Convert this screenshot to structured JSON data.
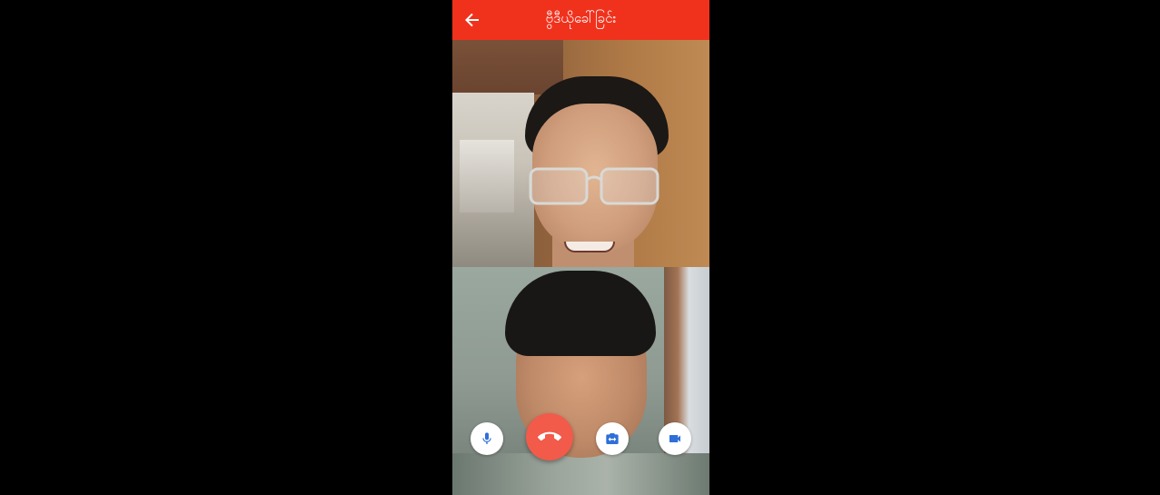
{
  "appbar": {
    "title": "ဗွီဒီယိုခေါ်ခြင်း",
    "background": "#f0321d",
    "back_icon": "arrow-back-icon"
  },
  "call": {
    "remote_feed": "remote-participant-video",
    "local_feed": "local-camera-preview",
    "controls": [
      {
        "name": "microphone-button",
        "icon": "microphone-icon",
        "color": "#2f6fd8"
      },
      {
        "name": "end-call-button",
        "icon": "phone-hangup-icon",
        "color": "#f25a4a"
      },
      {
        "name": "switch-camera-button",
        "icon": "camera-switch-icon",
        "color": "#2f6fd8"
      },
      {
        "name": "video-toggle-button",
        "icon": "video-camera-icon",
        "color": "#2f6fd8"
      }
    ]
  },
  "colors": {
    "accent": "#f0321d",
    "end_call": "#f25a4a",
    "control_icon": "#2f6fd8",
    "page_background": "#000000"
  }
}
